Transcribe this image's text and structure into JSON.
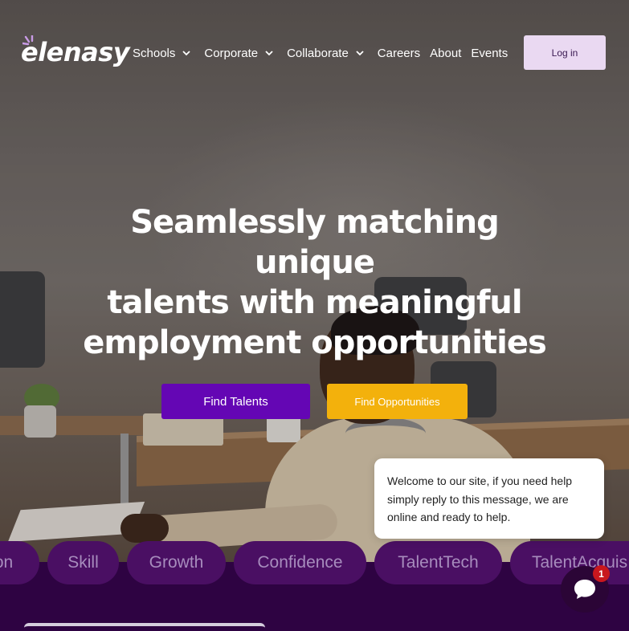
{
  "header": {
    "logo_text": "elenasy",
    "nav": [
      {
        "label": "Schools",
        "has_dropdown": true
      },
      {
        "label": "Corporate",
        "has_dropdown": true
      },
      {
        "label": "Collaborate",
        "has_dropdown": true
      },
      {
        "label": "Careers",
        "has_dropdown": false
      },
      {
        "label": "About",
        "has_dropdown": false
      },
      {
        "label": "Events",
        "has_dropdown": false
      }
    ],
    "login_label": "Log in"
  },
  "hero": {
    "title_line1": "Seamlessly matching unique",
    "title_line2": "talents with meaningful",
    "title_line3": "employment opportunities",
    "find_talents_label": "Find Talents",
    "find_opportunities_label": "Find Opportunities"
  },
  "chat": {
    "message": "Welcome to our site, if you need help simply reply to this message, we are online and ready to help.",
    "unread_count": "1"
  },
  "tags": [
    "on",
    "Skill",
    "Growth",
    "Confidence",
    "TalentTech",
    "TalentAcquis"
  ],
  "colors": {
    "primary_purple": "#6406b4",
    "accent_yellow": "#f3b10c",
    "band_purple": "#2e0342",
    "tag_purple": "#4a0f63",
    "login_bg": "#ead9f2",
    "badge_red": "#c8171e"
  },
  "icons": {
    "nav_dropdown": "chevron-down-icon",
    "chat_launcher": "chat-bubble-icon"
  }
}
